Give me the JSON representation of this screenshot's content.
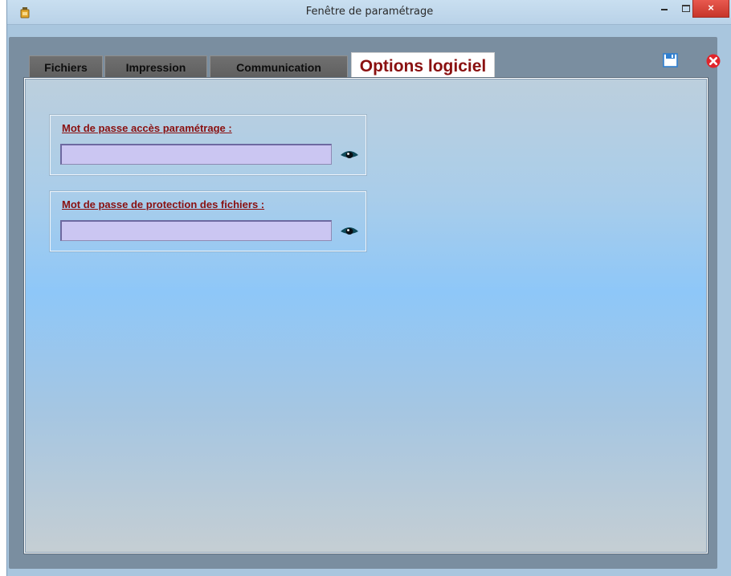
{
  "window": {
    "title": "Fenêtre de paramétrage",
    "close_label": "×"
  },
  "tabs": [
    {
      "label": "Fichiers",
      "active": false
    },
    {
      "label": "Impression",
      "active": false
    },
    {
      "label": "Communication",
      "active": false
    },
    {
      "label": "Options logiciel",
      "active": true
    }
  ],
  "toolbar": {
    "save_icon": "save-icon",
    "cancel_icon": "cancel-icon"
  },
  "groups": {
    "access": {
      "label": "Mot de passe accès paramétrage :",
      "value": ""
    },
    "protection": {
      "label": "Mot de passe de protection des fichiers :",
      "value": ""
    }
  },
  "colors": {
    "accent_red": "#8a1010",
    "input_bg": "#cbc6f2",
    "close_button": "#c7352a"
  }
}
